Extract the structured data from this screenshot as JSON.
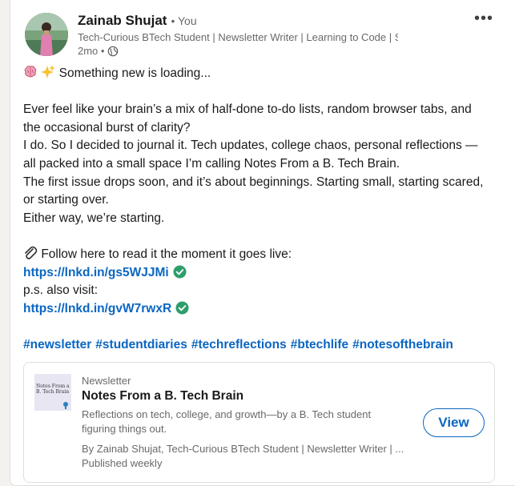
{
  "post": {
    "author": {
      "name": "Zainab Shujat",
      "relation": "• You",
      "headline": "Tech-Curious BTech Student | Newsletter Writer | Learning to Code | Sharing T...",
      "time": "2mo •"
    },
    "more_label": "•••",
    "body": {
      "intro": "Something new is loading...",
      "p1_line1": "Ever feel like your brain’s a mix of half-done to-do lists, random browser tabs, and",
      "p1_line2": "the occasional burst of clarity?",
      "p2_line1": "I do. So I decided to journal it. Tech updates, college chaos, personal reflections —",
      "p2_line2": "all packed into a small space I’m calling Notes From a B. Tech Brain.",
      "p3_line1": "The first issue drops soon, and it’s about beginnings. Starting small, starting scared,",
      "p3_line2": "or starting over.",
      "p4": "Either way, we’re starting.",
      "follow": "Follow here to read it the moment it goes live:",
      "link1": "https://lnkd.in/gs5WJJMi",
      "ps": "p.s. also visit:",
      "link2": "https://lnkd.in/gvW7rwxR"
    },
    "hashtags": [
      "#newsletter",
      "#studentdiaries",
      "#techreflections",
      "#btechlife",
      "#notesofthebrain"
    ]
  },
  "newsletter": {
    "thumb_text": "Notes From a B. Tech Brain",
    "kind": "Newsletter",
    "title": "Notes From a B. Tech Brain",
    "desc_line1": "Reflections on tech, college, and growth—by a B. Tech student",
    "desc_line2": "figuring things out.",
    "by": "By Zainab Shujat, Tech-Curious BTech Student | Newsletter Writer | ...",
    "frequency": "Published weekly",
    "view_label": "View"
  },
  "colors": {
    "link": "#0a66c2",
    "verified": "#2e9e6b",
    "background": "#f4f2ee"
  },
  "icons": [
    "globe-icon",
    "more-icon",
    "brain-icon",
    "sparkles-icon",
    "paperclip-icon",
    "verified-check-icon"
  ]
}
